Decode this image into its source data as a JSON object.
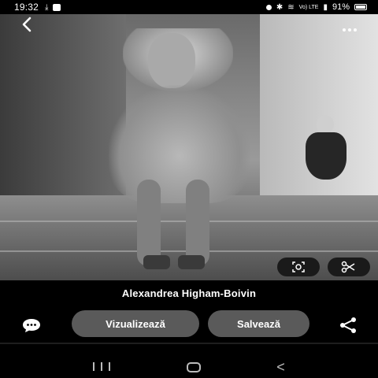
{
  "status_bar": {
    "time": "19:32",
    "battery": "91%",
    "network": "Vo) LTE",
    "icons": [
      "download-icon",
      "image-icon",
      "alarm-icon",
      "bluetooth-icon",
      "wifi-icon",
      "signal-icon",
      "battery-icon"
    ]
  },
  "photo": {
    "description_icons": [
      "back-arrow-icon",
      "more-options-icon",
      "visual-search-icon",
      "scissors-icon"
    ]
  },
  "info": {
    "title": "Alexandrea Higham-Boivin",
    "view_label": "Vizualizează",
    "save_label": "Salvează"
  },
  "colors": {
    "background": "#000000",
    "button": "#5a5a5a",
    "pill": "#1a1a1a",
    "text": "#ffffff"
  },
  "navbar": {
    "icons": [
      "recents-icon",
      "home-icon",
      "back-icon"
    ]
  }
}
